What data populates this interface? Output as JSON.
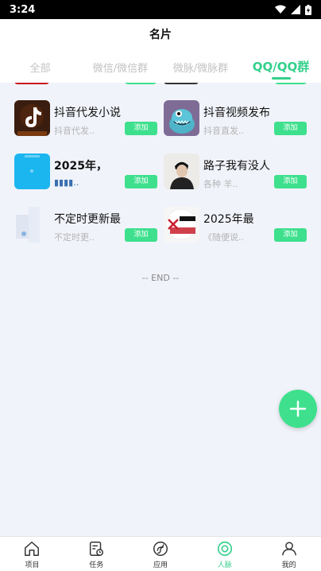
{
  "status_bar": {
    "time": "3:24"
  },
  "header": {
    "title": "名片"
  },
  "tabs": [
    {
      "label": "全部"
    },
    {
      "label": "微信/微信群"
    },
    {
      "label": "微脉/微脉群"
    },
    {
      "label": "QQ/QQ群"
    }
  ],
  "active_tab": "QQ/QQ群",
  "cards": [
    {
      "name": "抖音代发小说",
      "desc": "抖音代发..",
      "add_label": "添加",
      "icon": "tiktok-avatar"
    },
    {
      "name": "抖音视频发布",
      "desc": "抖音直发..",
      "add_label": "添加",
      "icon": "cartoon-monster-avatar"
    },
    {
      "name": "2025年，",
      "desc": "▮▮▮▮..",
      "add_label": "添加",
      "icon": "blue-app-avatar"
    },
    {
      "name": "路子我有没人",
      "desc": "各种 羊..",
      "add_label": "添加",
      "icon": "person-photo-avatar"
    },
    {
      "name": "不定时更新最",
      "desc": "不定时更..",
      "add_label": "添加",
      "icon": "faded-qq-avatar"
    },
    {
      "name": "2025年最",
      "desc": "《随便说..",
      "add_label": "添加",
      "icon": "poster-avatar"
    }
  ],
  "end_text": "-- END --",
  "fab_icon": "plus-icon",
  "bottom_nav": [
    {
      "label": "项目",
      "icon": "home-icon"
    },
    {
      "label": "任务",
      "icon": "task-icon"
    },
    {
      "label": "应用",
      "icon": "app-icon"
    },
    {
      "label": "人脉",
      "icon": "contacts-icon"
    },
    {
      "label": "我的",
      "icon": "profile-icon"
    }
  ],
  "active_nav": "人脉",
  "colors": {
    "accent": "#3ee08d",
    "accent_text": "#34d08c",
    "background": "#f1f3fa"
  }
}
